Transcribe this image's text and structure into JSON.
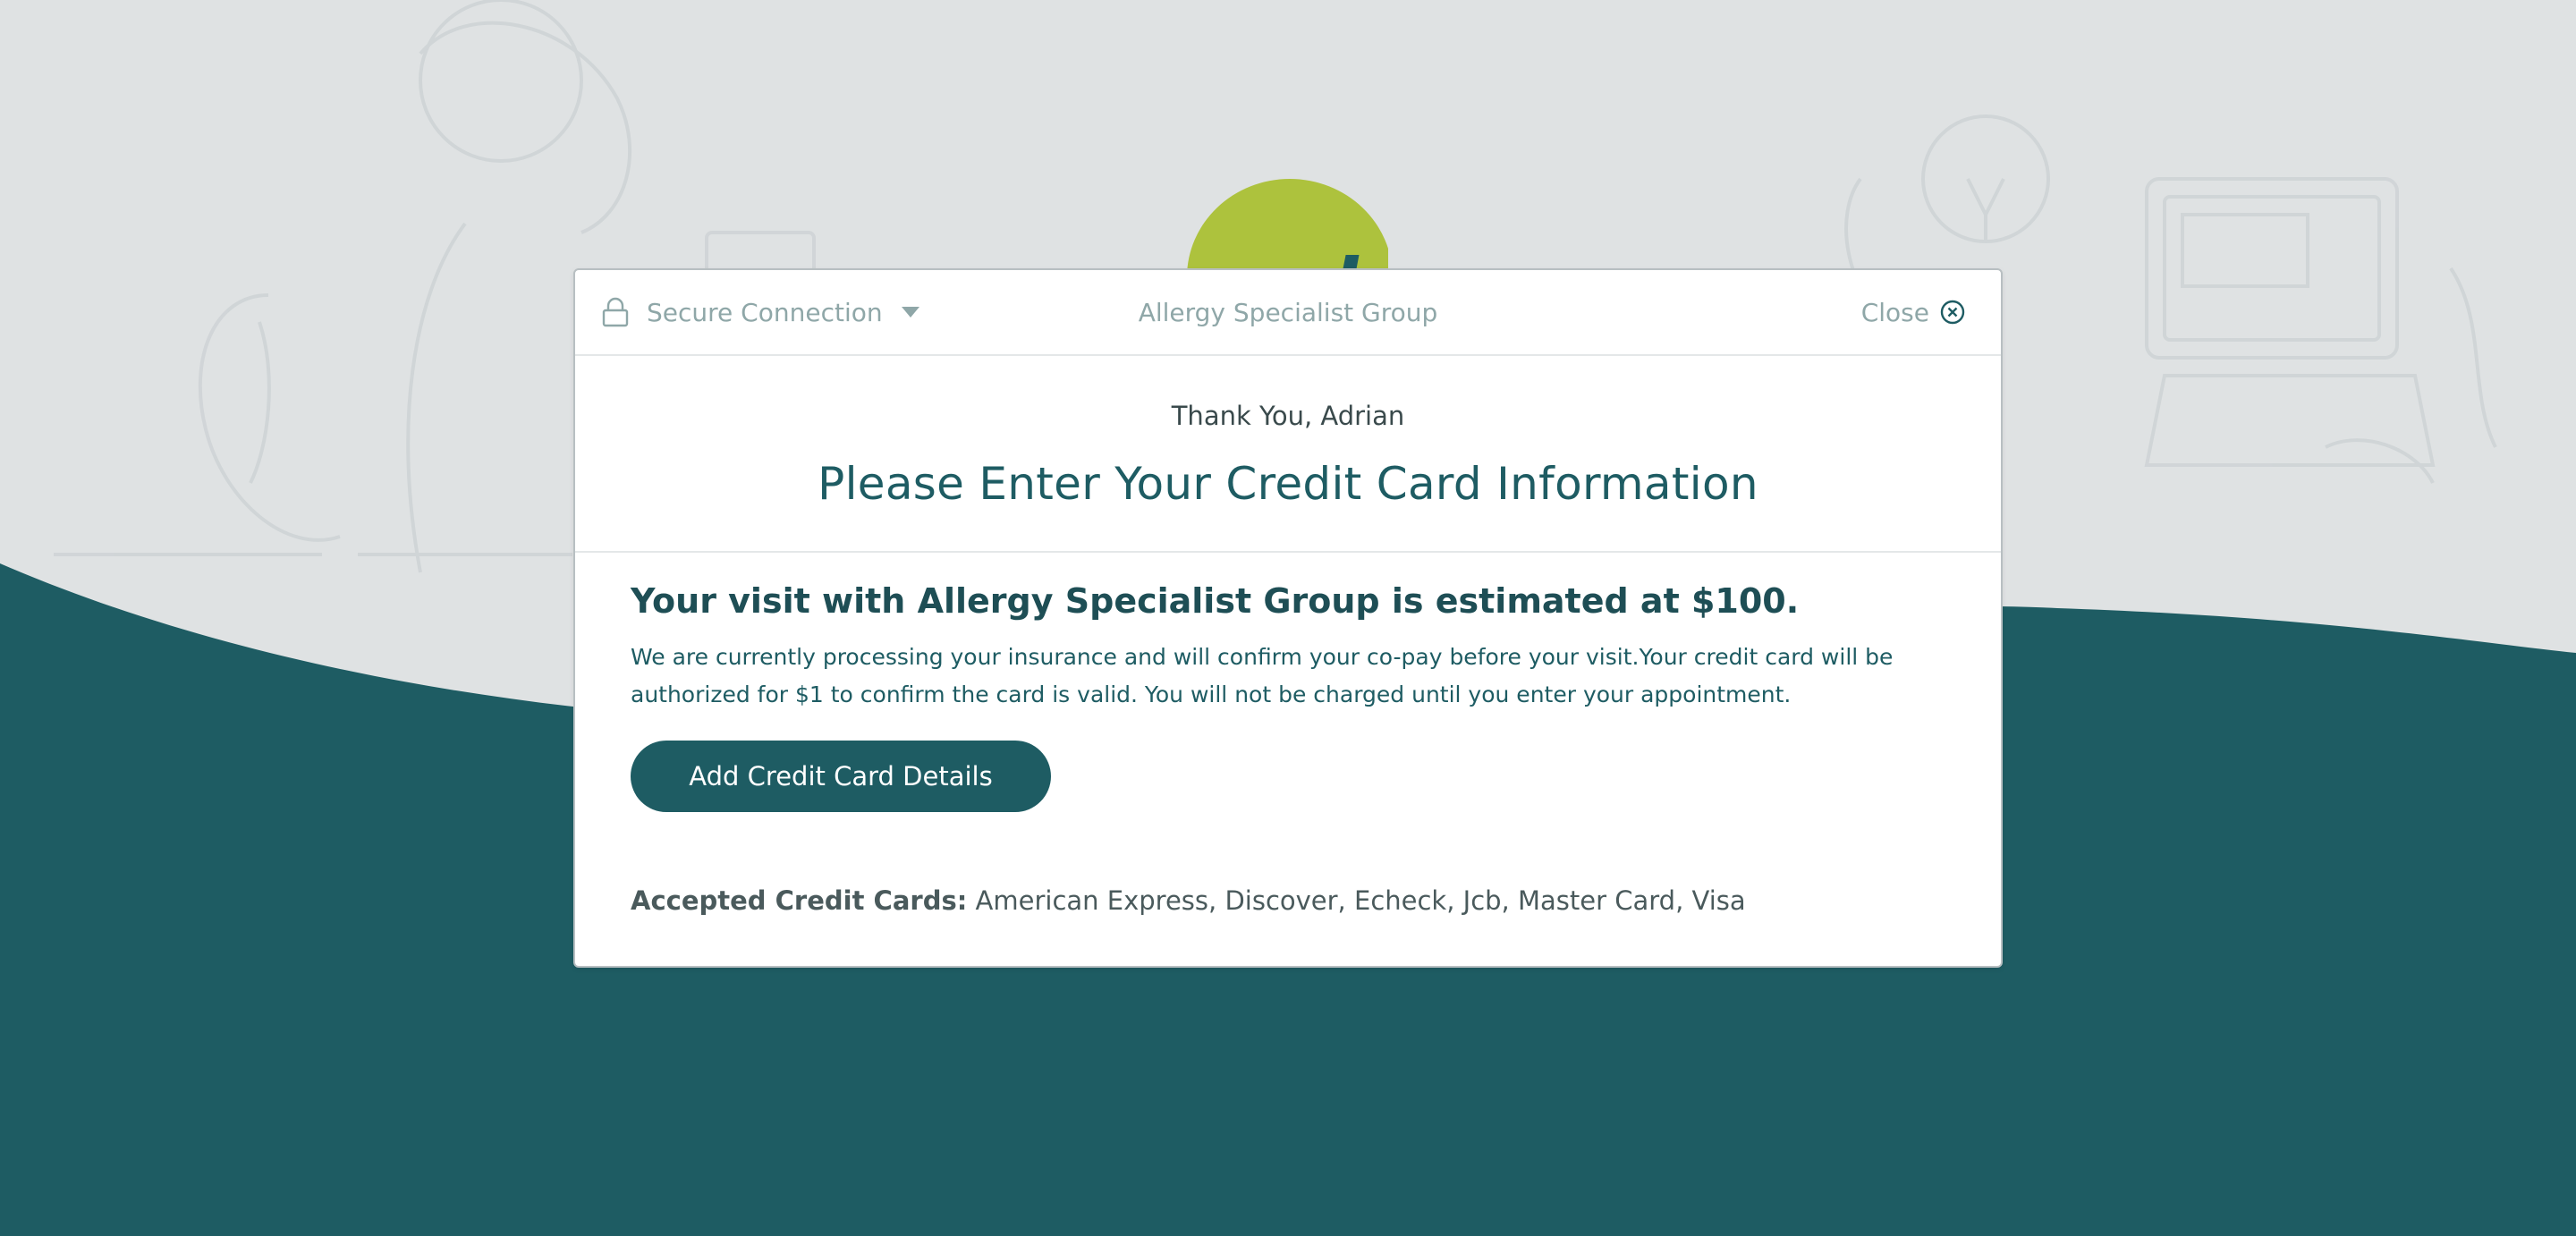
{
  "colors": {
    "primary": "#1e5c63",
    "accent_green": "#adc23d",
    "muted_text": "#8fa7a8",
    "background": "#dfe2e3"
  },
  "logo_fragment": "ned",
  "header": {
    "secure_label": "Secure Connection",
    "title": "Allergy Specialist Group",
    "close_label": "Close"
  },
  "intro": {
    "thanks": "Thank You, Adrian",
    "headline": "Please Enter Your Credit Card Information"
  },
  "body": {
    "estimate": "Your visit with Allergy Specialist Group is estimated at $100.",
    "note": "We are currently processing your insurance and will confirm your co-pay before your visit.Your credit card will be authorized for $1 to confirm the card is valid. You will not be charged until you enter your appointment.",
    "button_label": "Add Credit Card Details"
  },
  "accepted": {
    "label": "Accepted Credit Cards:",
    "value": " American Express, Discover, Echeck, Jcb, Master Card, Visa"
  },
  "icons": [
    "lock-icon",
    "caret-down-icon",
    "close-circle-icon"
  ]
}
